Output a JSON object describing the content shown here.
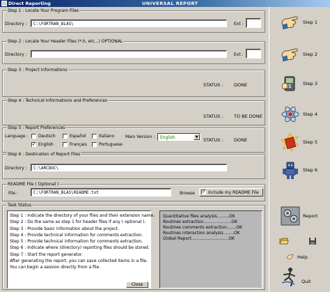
{
  "window": {
    "title": "Direct Reporting",
    "center_title": "UNIVERSAL REPORT"
  },
  "step1": {
    "legend": "Step 1 : Locate Your Program Files",
    "dir_label": "Directory :",
    "dir_value": "C:\\FORTRAN_BLAS\\",
    "ext_label": "Ext :",
    "ext_value": ""
  },
  "step2": {
    "legend": "Step 2 : Locate Your Header Files (*.h, etc...)     OPTIONAL",
    "dir_label": "Directory :",
    "dir_value": "",
    "ext_label": "Ext :",
    "ext_value": ""
  },
  "step3": {
    "legend": "Step 3 : Project Informations",
    "status_label": "STATUS :",
    "status_value": "DONE"
  },
  "step4": {
    "legend": "Step 4 : Technical Informations and Preferences",
    "status_label": "STATUS :",
    "status_value": "TO BE DONE"
  },
  "step5": {
    "legend": "Step 5 : Report Preferences",
    "language_label": "Language :",
    "languages": [
      {
        "name": "Deutsch",
        "checked": false
      },
      {
        "name": "Español",
        "checked": false
      },
      {
        "name": "Italiano",
        "checked": false
      },
      {
        "name": "English",
        "checked": true
      },
      {
        "name": "Français",
        "checked": false
      },
      {
        "name": "Portuguese",
        "checked": false
      }
    ],
    "main_version_label": "Main Version :",
    "main_version_value": "English",
    "status_label": "STATUS :",
    "status_value": "DONE"
  },
  "step6": {
    "legend": "Step 6 : Destination of Report Files",
    "dir_label": "Directory :",
    "dir_value": "C:\\ARCDOC\\"
  },
  "readme": {
    "legend": "README File ( Optional )",
    "file_label": "File :",
    "file_value": "C:\\FORTRAN_BLAS\\README.txt",
    "browse_label": "Browse",
    "include_label": "Include my README File",
    "include_checked": true
  },
  "task": {
    "legend": "Task Status",
    "lines": [
      "Step 1 : Indicate the directory of your files and their extension name.",
      "Step 2 : Do the same as step 1 for header files if any ( optional ).",
      "Step 3 : Provide basic information about the project.",
      "Step 4 : Provide technical information for comments extraction.",
      "Step 5 : Provide technical information for comments extraction.",
      "Step 6 : Indicate where (directory) reporting files should be stored.",
      "Step 7 : Start the report generator.",
      "After generating the report, you can save collected items in a file.",
      "You can begin a session directly from a file."
    ],
    "close_label": "Close",
    "report_lines": [
      "Quantitative files analysis.........OK",
      "Routines extraction.....................OK",
      "Routines comments extraction.......OK",
      "Routines interaction analysis........OK",
      "Global Report............................OK"
    ]
  },
  "sidebar": {
    "steps": [
      "Step 1",
      "Step 2",
      "Step 3",
      "Step 4",
      "Step 5",
      "Step 6"
    ],
    "report_label": "Report",
    "help_label": "Help",
    "quit_label": "Quit"
  }
}
